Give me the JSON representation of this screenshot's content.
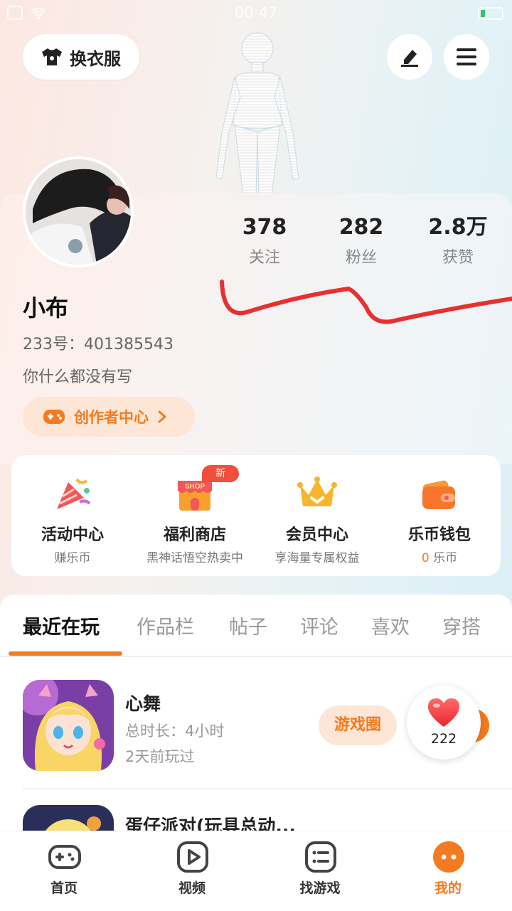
{
  "status_bar": {
    "time": "00:47"
  },
  "top": {
    "change_clothes_label": "换衣服",
    "edit_icon": "pen-icon",
    "menu_icon": "hamburger-icon"
  },
  "profile": {
    "stats": [
      {
        "value": "378",
        "label": "关注"
      },
      {
        "value": "282",
        "label": "粉丝"
      },
      {
        "value": "2.8万",
        "label": "获赞"
      }
    ],
    "name": "小布",
    "uid": "233号：401385543",
    "bio": "你什么都没有写",
    "creator_center_label": "创作者中心"
  },
  "features": [
    {
      "title": "活动中心",
      "subtitle": "赚乐币",
      "icon": "party-horn-icon"
    },
    {
      "title": "福利商店",
      "subtitle": "黑神话悟空热卖中",
      "icon": "shop-icon",
      "badge": "新"
    },
    {
      "title": "会员中心",
      "subtitle": "享海量专属权益",
      "icon": "crown-icon"
    },
    {
      "title": "乐币钱包",
      "subtitle_value": "0",
      "subtitle_unit": "乐币",
      "icon": "wallet-icon"
    }
  ],
  "tabs": [
    "最近在玩",
    "作品栏",
    "帖子",
    "评论",
    "喜欢",
    "穿搭"
  ],
  "games": [
    {
      "title": "心舞",
      "duration": "总时长：4小时",
      "last_played": "2天前玩过",
      "button": "游戏圈"
    },
    {
      "title": "蛋仔派对(玩具总动..."
    }
  ],
  "like_bubble": {
    "count": "222"
  },
  "bottom_nav": [
    {
      "label": "首页",
      "icon": "gamepad-icon"
    },
    {
      "label": "视频",
      "icon": "play-icon"
    },
    {
      "label": "找游戏",
      "icon": "list-icon"
    },
    {
      "label": "我的",
      "icon": "face-icon",
      "active": true
    }
  ],
  "colors": {
    "accent": "#f47a1f",
    "badge": "#f24f3b",
    "scribble": "#e8302f"
  }
}
